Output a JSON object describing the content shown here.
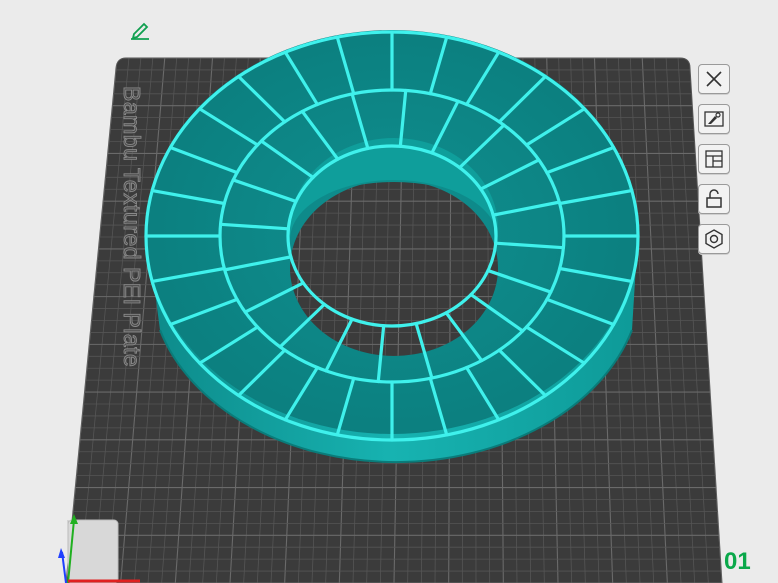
{
  "plate": {
    "label": "Bambu Textured PEI Plate",
    "index": "01"
  },
  "plate_tools": [
    {
      "name": "delete-plate-icon"
    },
    {
      "name": "arrange-plate-icon"
    },
    {
      "name": "plate-layout-icon"
    },
    {
      "name": "lock-plate-icon"
    },
    {
      "name": "plate-settings-icon"
    }
  ],
  "icons": {
    "edit": "edit-pencil-icon"
  },
  "colors": {
    "background": "#ebebeb",
    "plate": "#3b3b3b",
    "grid": "#5d5d5d",
    "model_body": "#12a3a3",
    "model_edge": "#3ff1ec",
    "plate_index": "#0aa84a"
  }
}
